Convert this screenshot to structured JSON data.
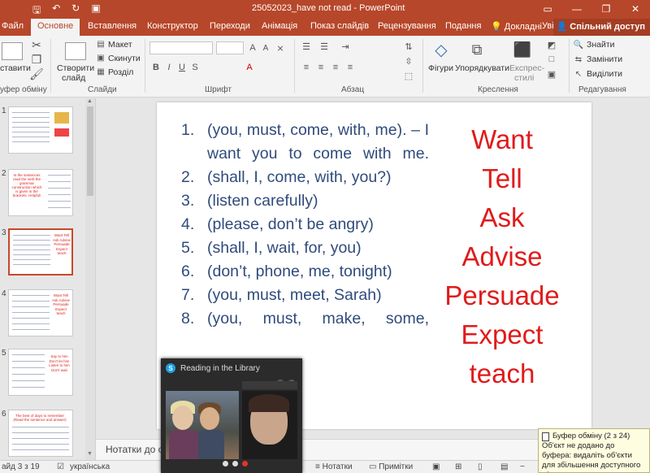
{
  "window": {
    "title": "25052023_have not read - PowerPoint",
    "qat_icons": [
      "save-icon",
      "undo-icon",
      "redo-icon",
      "start-slideshow-icon"
    ]
  },
  "tabs": [
    {
      "label": "Файл",
      "active": false
    },
    {
      "label": "Основне",
      "active": true
    },
    {
      "label": "Вставлення",
      "active": false
    },
    {
      "label": "Конструктор",
      "active": false
    },
    {
      "label": "Переходи",
      "active": false
    },
    {
      "label": "Анімація",
      "active": false
    },
    {
      "label": "Показ слайдів",
      "active": false
    },
    {
      "label": "Рецензування",
      "active": false
    },
    {
      "label": "Подання",
      "active": false
    },
    {
      "label": "Докладні",
      "active": false
    },
    {
      "label": "Увійти",
      "active": false
    }
  ],
  "share_label": "Спільний доступ",
  "ribbon": {
    "paste_label": "ставити",
    "new_slide_label_1": "Створити",
    "new_slide_label_2": "слайд",
    "layout_label": "Макет",
    "reset_label": "Скинути",
    "section_label": "Розділ",
    "find_label": "Знайти",
    "replace_label": "Замінити",
    "select_label": "Виділити",
    "shapes_label": "Фігури",
    "arrange_label": "Упорядкувати",
    "quick_styles_label_1": "Експрес-",
    "quick_styles_label_2": "стилі",
    "groups": {
      "clipboard": "уфер обміну",
      "slides": "Слайди",
      "font": "Шрифт",
      "paragraph": "Абзац",
      "drawing": "Креслення",
      "editing": "Редагування"
    }
  },
  "thumbnails": {
    "numbers": [
      "1",
      "2",
      "3",
      "4",
      "5",
      "6"
    ],
    "t2_text": "In the sentences read the verb the grammar construction which is given in the brackets. Helpful!",
    "t3_words": "Want Tell Ask Advise Persuade Expect teach",
    "t4_words": "Want Tell Ask Advise Persuade Expect teach",
    "t5_words": "Say to him Don't let him Listen to him Don't wait",
    "t6_text": "The best of days to remember (Read the sentence and answer)"
  },
  "slide": {
    "items": [
      {
        "num": "1.",
        "text": "(you, must, come, with, me). – I want you to come with me."
      },
      {
        "num": "2.",
        "text": "(shall, I, come, with, you?)"
      },
      {
        "num": "3.",
        "text": "(listen carefully)"
      },
      {
        "num": "4.",
        "text": "(please, don’t be angry)"
      },
      {
        "num": "5.",
        "text": "(shall, I, wait, for, you)"
      },
      {
        "num": "6.",
        "text": "(don’t, phone, me, tonight)"
      },
      {
        "num": "7.",
        "text": "(you, must, meet, Sarah)"
      },
      {
        "num": "8.",
        "text": "(you, must, make, some,"
      }
    ],
    "words": [
      "Want",
      "Tell",
      "Ask",
      "Advise",
      "Persuade",
      "Expect",
      "teach"
    ]
  },
  "notes_placeholder": "Нотатки до с",
  "status": {
    "slide_of": "айд 3 з 19",
    "language": "українська",
    "notes_label": "Нотатки",
    "comments_label": "Примітки"
  },
  "call": {
    "title": "Reading in the Library"
  },
  "tooltip": {
    "title": "Буфер обміну (2 з 24)",
    "body": "Об'єкт не додано до буфера: видаліть об'єкти для збільшення доступного місця"
  },
  "colors": {
    "accent": "#b7472a",
    "slide_text": "#2f4b7c",
    "slide_red": "#e01b1b"
  }
}
